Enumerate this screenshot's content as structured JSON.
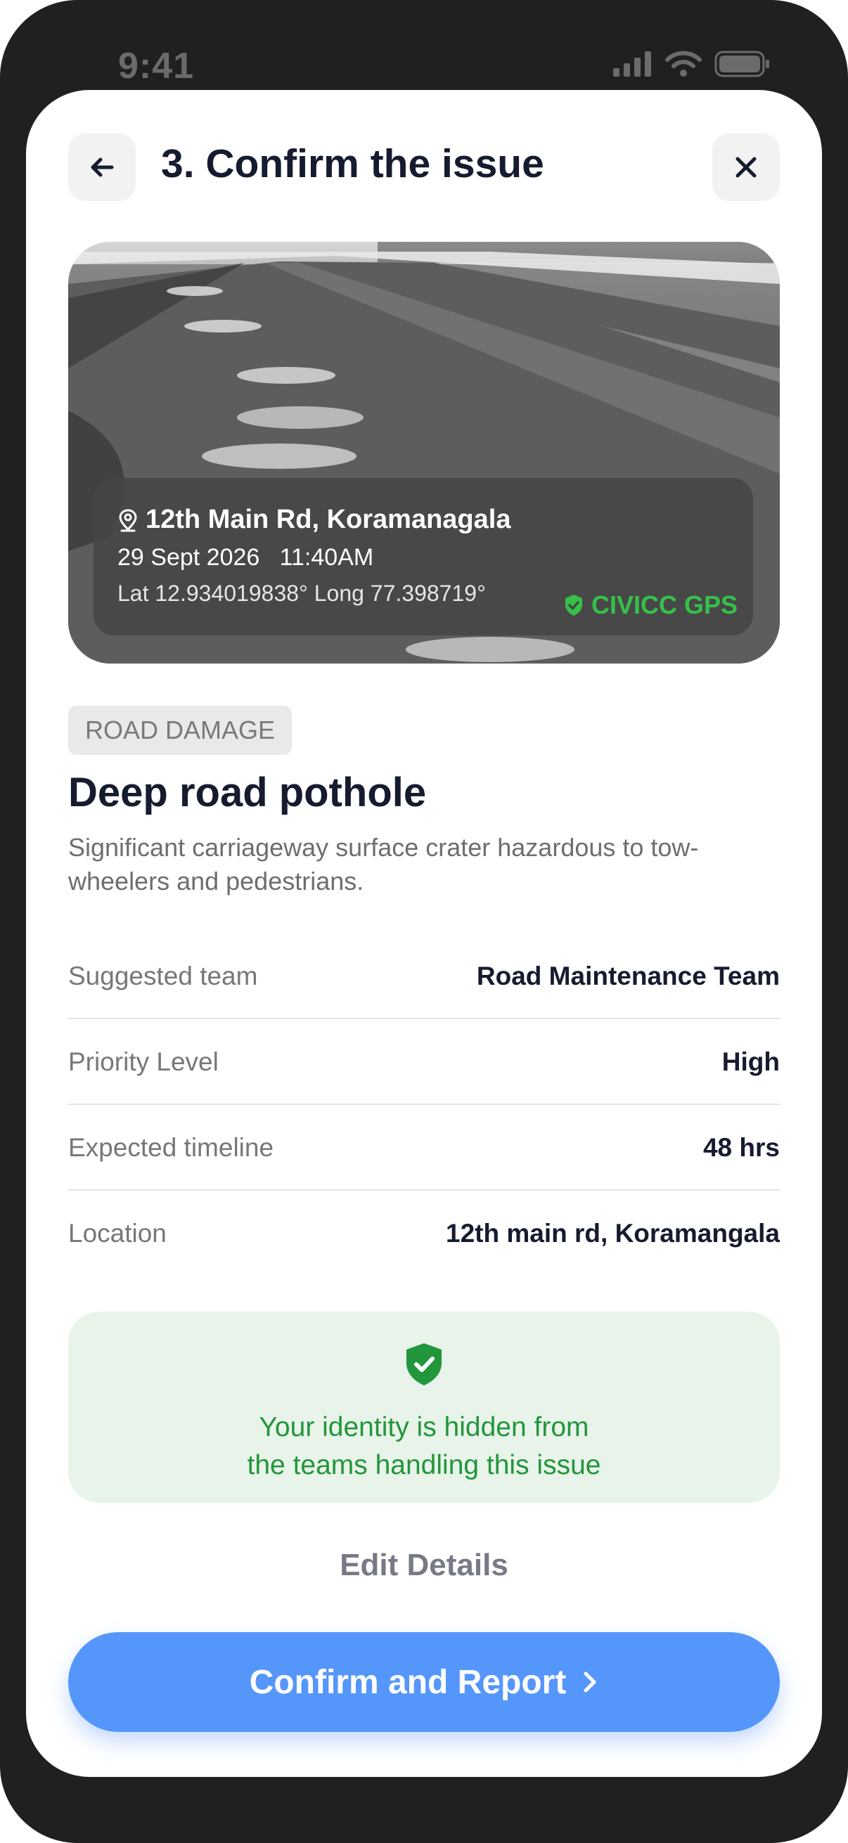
{
  "status_bar": {
    "time": "9:41"
  },
  "header": {
    "title": "3. Confirm the issue",
    "back_icon": "arrow-left-icon",
    "close_icon": "close-icon"
  },
  "photo": {
    "address": "12th Main Rd, Koramanagala",
    "datetime": "29 Sept 2026   11:40AM",
    "coordinates": "Lat 12.934019838° Long 77.398719°",
    "badge": "CIVICC GPS"
  },
  "issue": {
    "category": "ROAD DAMAGE",
    "title": "Deep road pothole",
    "description": "Significant carriageway surface crater hazardous to tow-wheelers and pedestrians."
  },
  "details": [
    {
      "label": "Suggested team",
      "value": "Road Maintenance Team"
    },
    {
      "label": "Priority Level",
      "value": "High"
    },
    {
      "label": "Expected timeline",
      "value": "48 hrs"
    },
    {
      "label": "Location",
      "value": "12th main rd, Koramangala"
    }
  ],
  "privacy": {
    "line1": "Your identity is hidden from",
    "line2": "the teams handling this issue"
  },
  "actions": {
    "edit_label": "Edit Details",
    "confirm_label": "Confirm and Report"
  },
  "colors": {
    "primary": "#5596fb",
    "success": "#22963a",
    "gps_badge": "#36c04a",
    "title": "#161b2f"
  }
}
